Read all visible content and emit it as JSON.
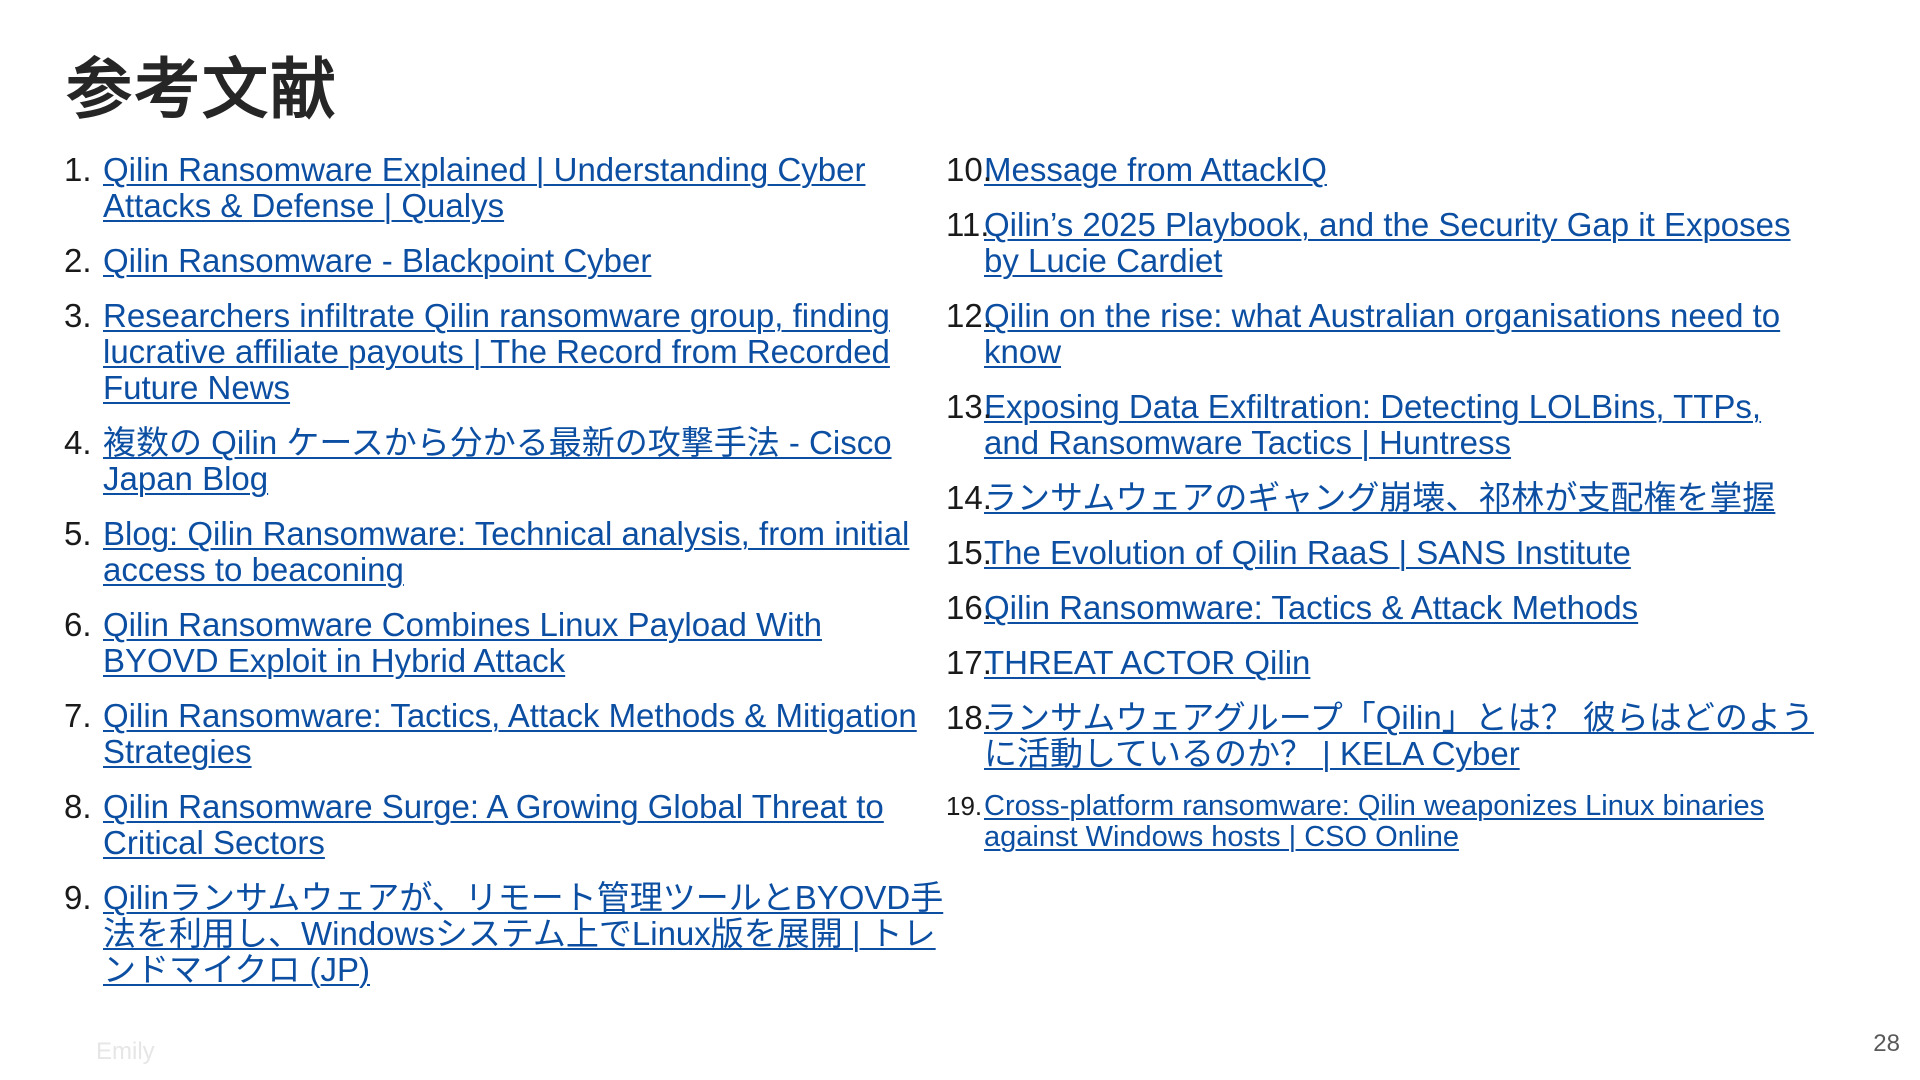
{
  "title": "参考文献",
  "references_left": [
    {
      "num": "1.",
      "text": "Qilin Ransomware Explained | Understanding Cyber Attacks & Defense | Qualys"
    },
    {
      "num": "2.",
      "text": "Qilin Ransomware - Blackpoint Cyber"
    },
    {
      "num": "3.",
      "text": "Researchers infiltrate Qilin ransomware group, finding lucrative affiliate payouts | The Record from Recorded Future News"
    },
    {
      "num": "4.",
      "text": "複数の Qilin ケースから分かる最新の攻撃手法 - Cisco Japan Blog"
    },
    {
      "num": "5.",
      "text": "Blog: Qilin Ransomware: Technical analysis, from initial access to beaconing"
    },
    {
      "num": "6.",
      "text": "Qilin Ransomware Combines Linux Payload With BYOVD Exploit in Hybrid Attack"
    },
    {
      "num": "7.",
      "text": "Qilin Ransomware: Tactics, Attack Methods & Mitigation Strategies"
    },
    {
      "num": "8.",
      "text": "Qilin Ransomware Surge: A Growing Global Threat to Critical Sectors"
    },
    {
      "num": "9.",
      "text": "Qilinランサムウェアが、リモート管理ツールとBYOVD手法を利用し、Windowsシステム上でLinux版を展開 | トレンドマイクロ (JP)"
    }
  ],
  "references_right": [
    {
      "num": "10.",
      "text": "Message from AttackIQ"
    },
    {
      "num": "11.",
      "text": "Qilin’s 2025 Playbook, and the Security Gap it Exposes by Lucie Cardiet"
    },
    {
      "num": "12.",
      "text": "Qilin on the rise: what Australian organisations need to know"
    },
    {
      "num": "13.",
      "text": "Exposing Data Exfiltration: Detecting LOLBins, TTPs, and Ransomware Tactics | Huntress"
    },
    {
      "num": "14.",
      "text": "ランサムウェアのギャング崩壊、祁林が支配権を掌握"
    },
    {
      "num": "15.",
      "text": "The Evolution of Qilin RaaS | SANS Institute"
    },
    {
      "num": "16.",
      "text": "Qilin Ransomware: Tactics & Attack Methods"
    },
    {
      "num": "17.",
      "text": "THREAT ACTOR Qilin"
    },
    {
      "num": "18.",
      "text": "ランサムウェアグループ「Qilin」とは？ 彼らはどのように活動しているのか？ | KELA Cyber"
    },
    {
      "num": "19.",
      "text": "Cross-platform ransomware: Qilin weaponizes Linux binaries against Windows hosts | CSO Online"
    }
  ],
  "footer": {
    "author": "Emily",
    "page_number": "28"
  },
  "colors": {
    "link": "#0b4ea2",
    "title": "#262626",
    "text": "#1a1a1a"
  }
}
